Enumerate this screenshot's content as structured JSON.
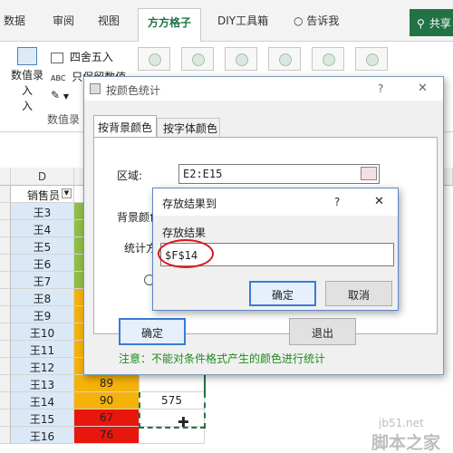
{
  "ribbon": {
    "tabs": [
      "数据",
      "审阅",
      "视图",
      "方方格子",
      "DIY工具箱"
    ],
    "active_tab": "方方格子",
    "tell_me": "告诉我",
    "share": "共享",
    "round_label": "四舍五入",
    "keep_value_label": "只保留数值",
    "data_entry_label": "数值录入",
    "data_entry_sub": "入",
    "group_label": "数值录"
  },
  "sheet": {
    "col_d": "D",
    "header_cell": "销售员",
    "rows": [
      {
        "name": "王3",
        "score": "",
        "fill": "#8fbf45",
        "result": ""
      },
      {
        "name": "王4",
        "score": "",
        "fill": "#8fbf45",
        "result": ""
      },
      {
        "name": "王5",
        "score": "",
        "fill": "#8fbf45",
        "result": ""
      },
      {
        "name": "王6",
        "score": "",
        "fill": "#8fbf45",
        "result": ""
      },
      {
        "name": "王7",
        "score": "",
        "fill": "#8fbf45",
        "result": ""
      },
      {
        "name": "王8",
        "score": "",
        "fill": "#f5b20a",
        "result": ""
      },
      {
        "name": "王9",
        "score": "",
        "fill": "#f5b20a",
        "result": ""
      },
      {
        "name": "王10",
        "score": "",
        "fill": "#f5b20a",
        "result": ""
      },
      {
        "name": "王11",
        "score": "",
        "fill": "#f5b20a",
        "result": ""
      },
      {
        "name": "王12",
        "score": "",
        "fill": "#f5b20a",
        "result": ""
      },
      {
        "name": "王13",
        "score": "89",
        "fill": "#f5b20a",
        "result": ""
      },
      {
        "name": "王14",
        "score": "90",
        "fill": "#f5b20a",
        "result": "575"
      },
      {
        "name": "王15",
        "score": "67",
        "fill": "#e8170e",
        "result": ""
      },
      {
        "name": "王16",
        "score": "76",
        "fill": "#e8170e",
        "result": ""
      }
    ]
  },
  "color_dialog": {
    "title": "按颜色统计",
    "help": "?",
    "close": "✕",
    "tab_bg": "按背景颜色",
    "tab_font": "按字体颜色",
    "range_label": "区域:",
    "range_value": "E2:E15",
    "bg_label": "背景颜色",
    "method_label": "统计方",
    "ok": "确定",
    "exit": "退出",
    "note": "注意：不能对条件格式产生的颜色进行统计"
  },
  "store_dialog": {
    "title": "存放结果到",
    "help": "?",
    "close": "✕",
    "field_label": "存放结果",
    "field_value": "$F$14",
    "ok": "确定",
    "cancel": "取消"
  },
  "watermark": {
    "site": "jb51.net",
    "name": "脚本之家"
  },
  "colors": {
    "accent_green": "#217346",
    "green_fill": "#8fbf45",
    "orange_fill": "#f5b20a",
    "red_fill": "#e8170e",
    "note_green": "#1e8a1e"
  }
}
